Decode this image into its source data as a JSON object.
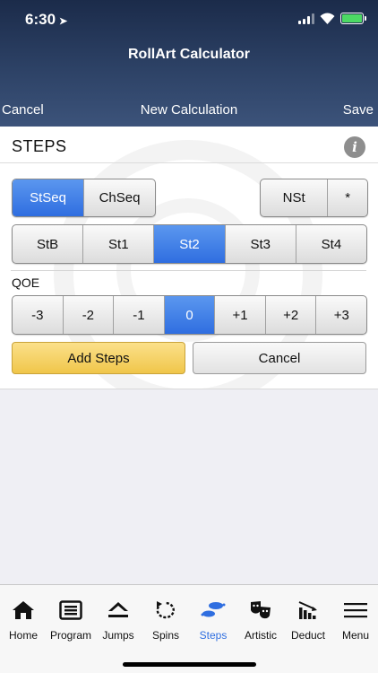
{
  "status": {
    "time": "6:30",
    "location_glyph": "➤"
  },
  "header": {
    "app_title": "RollArt Calculator",
    "cancel_label": "Cancel",
    "nav_title": "New Calculation",
    "save_label": "Save"
  },
  "section": {
    "title": "STEPS",
    "info_glyph": "i"
  },
  "sequence_type": {
    "options": [
      "StSeq",
      "ChSeq"
    ],
    "selected": "StSeq"
  },
  "special": {
    "options": [
      "NSt",
      "*"
    ]
  },
  "levels": {
    "options": [
      "StB",
      "St1",
      "St2",
      "St3",
      "St4"
    ],
    "selected": "St2"
  },
  "qoe": {
    "label": "QOE",
    "options": [
      "-3",
      "-2",
      "-1",
      "0",
      "+1",
      "+2",
      "+3"
    ],
    "selected": "0"
  },
  "actions": {
    "add_label": "Add Steps",
    "cancel_label": "Cancel"
  },
  "colors": {
    "accent": "#2f6ee0",
    "header": "#2d4266",
    "add_button": "#f0c64a"
  },
  "tabs": [
    {
      "label": "Home",
      "icon": "home-icon"
    },
    {
      "label": "Program",
      "icon": "program-icon"
    },
    {
      "label": "Jumps",
      "icon": "jumps-icon"
    },
    {
      "label": "Spins",
      "icon": "spins-icon"
    },
    {
      "label": "Steps",
      "icon": "steps-icon",
      "active": true
    },
    {
      "label": "Artistic",
      "icon": "artistic-icon"
    },
    {
      "label": "Deduct",
      "icon": "deduct-icon"
    },
    {
      "label": "Menu",
      "icon": "menu-icon"
    }
  ]
}
